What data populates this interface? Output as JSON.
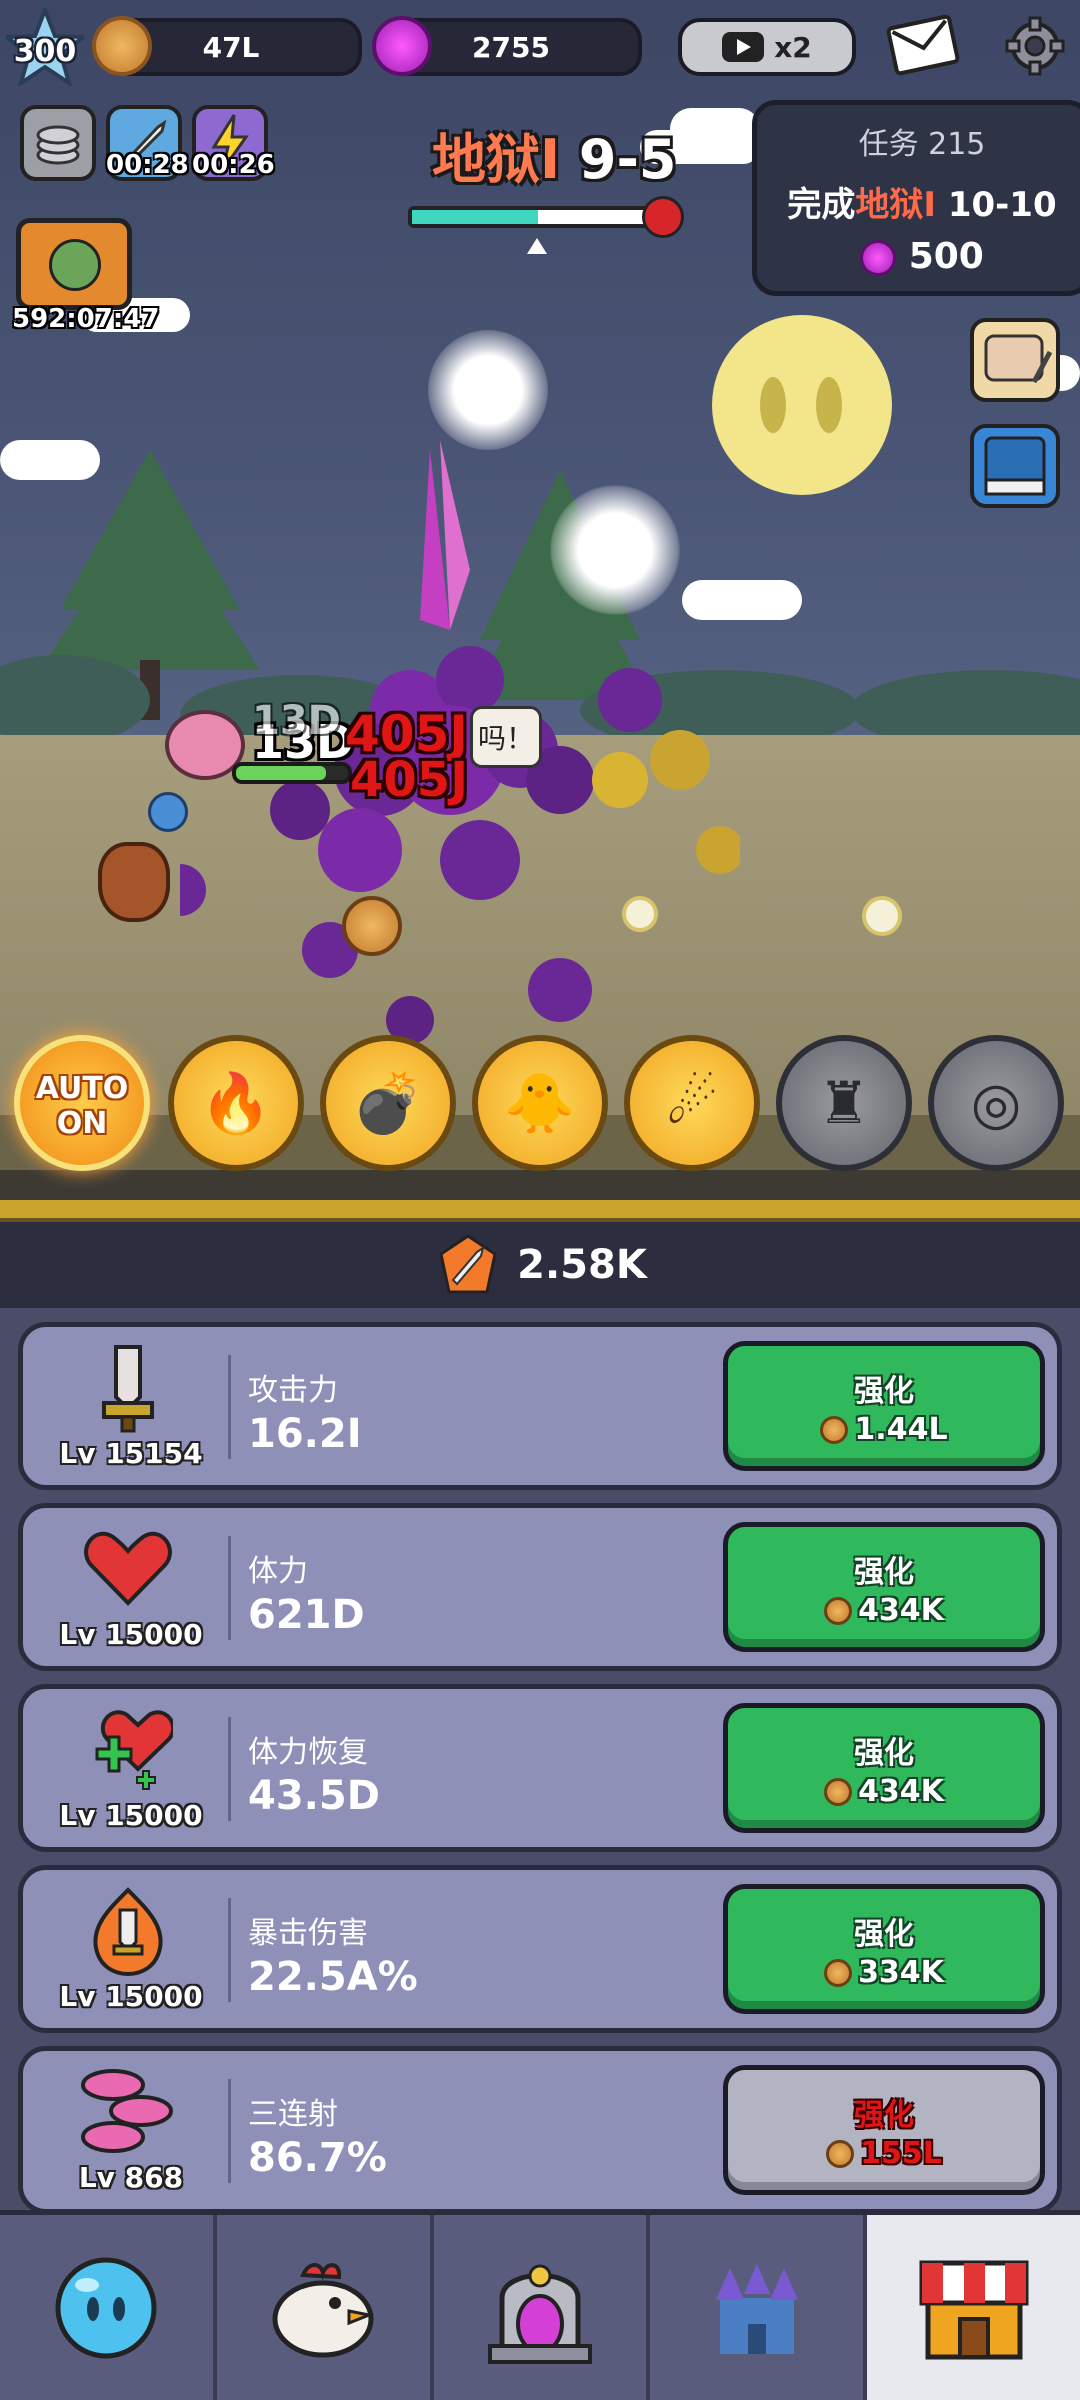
{
  "hud": {
    "level": "300",
    "gold": "47L",
    "gems": "2755",
    "ad_multiplier": "x2",
    "buff_timer_1": "00:28",
    "buff_timer_2": "00:26",
    "event_timer": "592:07:47"
  },
  "stage": {
    "title_red": "地狱I",
    "title_num": "9-5"
  },
  "quest": {
    "title": "任务 215",
    "desc_prefix": "完成",
    "desc_red": "地狱I",
    "desc_suffix": " 10-10",
    "reward": "500"
  },
  "combat_text": {
    "damage_1": "13D",
    "damage_2": "405J",
    "speech": "吗！"
  },
  "skills": {
    "auto_line1": "AUTO",
    "auto_line2": "ON"
  },
  "power": {
    "value": "2.58K"
  },
  "upgrades": [
    {
      "level": "Lv 15154",
      "name": "攻击力",
      "value": "16.2I",
      "button": "强化",
      "cost": "1.44L"
    },
    {
      "level": "Lv 15000",
      "name": "体力",
      "value": "621D",
      "button": "强化",
      "cost": "434K"
    },
    {
      "level": "Lv 15000",
      "name": "体力恢复",
      "value": "43.5D",
      "button": "强化",
      "cost": "434K"
    },
    {
      "level": "Lv 15000",
      "name": "暴击伤害",
      "value": "22.5A%",
      "button": "强化",
      "cost": "334K"
    },
    {
      "level": "Lv 868",
      "name": "三连射",
      "value": "86.7%",
      "button": "强化",
      "cost": "155L"
    }
  ],
  "icons": {
    "nav": [
      "slime-icon",
      "chicken-icon",
      "portal-icon",
      "castle-icon",
      "shop-icon"
    ]
  }
}
